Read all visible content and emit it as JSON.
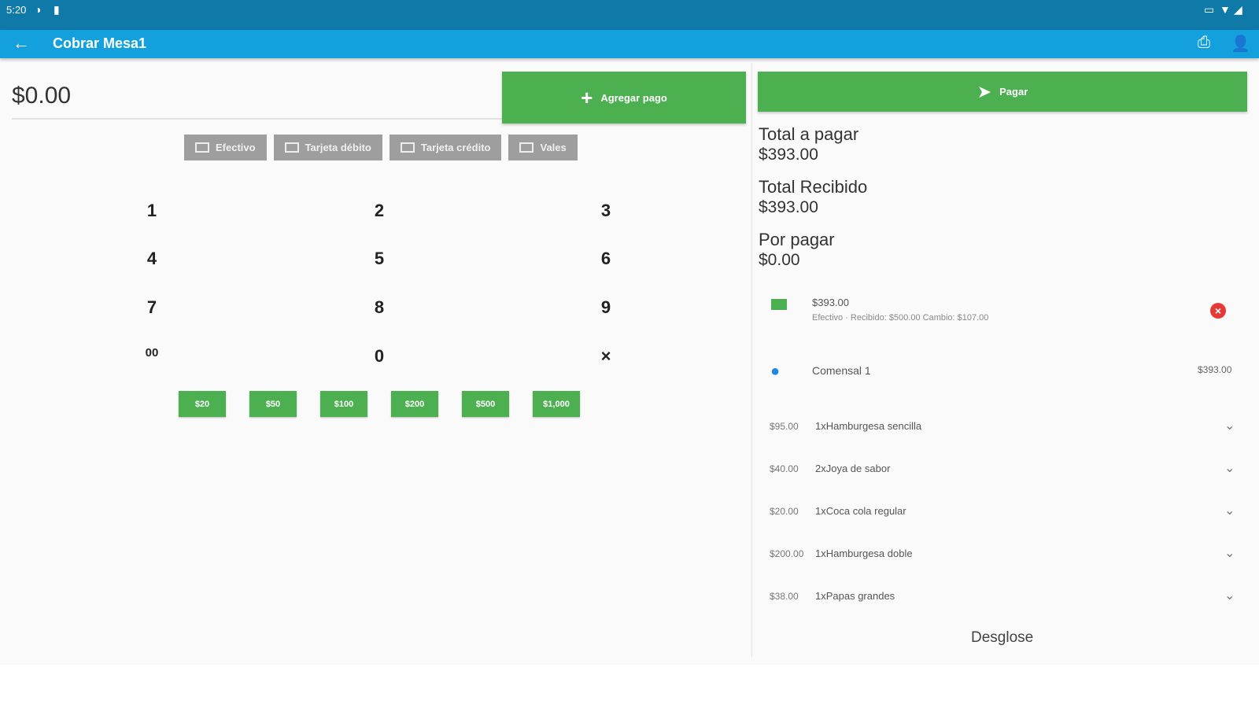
{
  "status": {
    "time": "5:20"
  },
  "appbar": {
    "title": "Cobrar Mesa1"
  },
  "entry": {
    "amount": "$0.00"
  },
  "add_payment_label": "Agregar pago",
  "methods": [
    {
      "label": "Efectivo",
      "icon": "cash-icon"
    },
    {
      "label": "Tarjeta débito",
      "icon": "card-icon"
    },
    {
      "label": "Tarjeta crédito",
      "icon": "card-icon"
    },
    {
      "label": "Vales",
      "icon": "voucher-icon"
    }
  ],
  "keypad": [
    "1",
    "2",
    "3",
    "4",
    "5",
    "6",
    "7",
    "8",
    "9",
    "00",
    "0",
    "×"
  ],
  "quick_amounts": [
    "$20",
    "$50",
    "$100",
    "$200",
    "$500",
    "$1,000"
  ],
  "pay_label": "Pagar",
  "totals": {
    "to_pay_label": "Total a pagar",
    "to_pay": "$393.00",
    "received_label": "Total Recibido",
    "received": "$393.00",
    "pending_label": "Por pagar",
    "pending": "$0.00"
  },
  "payment": {
    "amount": "$393.00",
    "detail": "Efectivo · Recibido: $500.00 Cambio: $107.00"
  },
  "diner": {
    "name": "Comensal 1",
    "total": "$393.00"
  },
  "items": [
    {
      "price": "$95.00",
      "name": "1xHamburgesa sencilla"
    },
    {
      "price": "$40.00",
      "name": "2xJoya de sabor"
    },
    {
      "price": "$20.00",
      "name": "1xCoca cola regular"
    },
    {
      "price": "$200.00",
      "name": "1xHamburgesa doble"
    },
    {
      "price": "$38.00",
      "name": "1xPapas grandes"
    }
  ],
  "desglose_label": "Desglose"
}
